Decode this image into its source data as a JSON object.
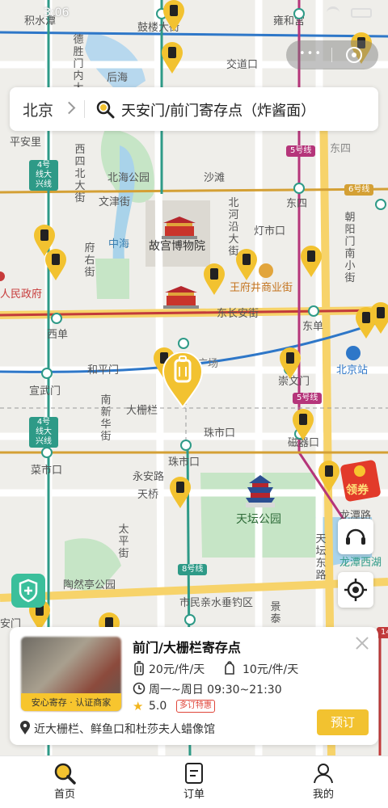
{
  "status_bar": {
    "time": "3:06"
  },
  "capsule": {
    "more": "•••"
  },
  "search": {
    "city": "北京",
    "query": "天安门/前门寄存点（炸酱面）"
  },
  "map_labels": {
    "jishuitan": "积水潭",
    "gulou": "鼓楼大街",
    "yonghegong": "雍和宫",
    "dongzhimen": "东直门",
    "deshengmen": "德胜门内大街",
    "houhai": "后海",
    "jiaodaokou": "交道口",
    "nanluogu": "南锣鼓巷",
    "pinganli": "平安里",
    "xisi": "西四北大街",
    "dongsi": "东四",
    "beihai": "北海公园",
    "wenjin": "文津街",
    "shatan": "沙滩",
    "beiheyan": "北河沿大街",
    "chaoyangmen": "朝阳门南小街",
    "zhonghai": "中海",
    "gugong": "故宫博物院",
    "dengshikou": "灯市口",
    "fuyou": "府右街",
    "wangfujing": "王府井商业街",
    "renmin": "人民政府",
    "dongchangan": "东长安街",
    "xidan": "西单",
    "dongdan": "东单",
    "beijingzhan": "北京站",
    "hepingmen": "和平门",
    "qianmen_guang": "广场",
    "xuanwumen": "宣武门",
    "chongwenmen": "崇文门",
    "nanxinhua": "南新华街",
    "dashilan": "大栅栏",
    "zhushikou_w": "珠市口",
    "zhushikou": "珠市口",
    "ciqikou": "磁器口",
    "caishikou": "菜市口",
    "yongan": "永安路",
    "tianqiao": "天桥",
    "tiantan": "天坛公园",
    "taiping": "太平街",
    "longtanlu": "龙潭路",
    "tiantandong": "天坛东路",
    "longtanxihu": "龙潭西湖",
    "taoranting": "陶然亭公园",
    "diaoyu": "市民亲水垂钓区",
    "jingtai": "景泰",
    "anmen": "安门",
    "l2": "2号线",
    "l4": "4号线大兴线",
    "l5": "5号线",
    "l6": "6号线",
    "l8": "8号线",
    "l14": "14"
  },
  "coupon": {
    "label": "领券"
  },
  "store": {
    "name": "前门/大栅栏寄存点",
    "badge": "安心寄存 · 认证商家",
    "price_luggage": "20元/件/天",
    "price_bag": "10元/件/天",
    "hours": "周一~周日 09:30~21:30",
    "rating": "5.0",
    "deal": "多订特惠",
    "book": "预订",
    "nearby": "近大栅栏、鲜鱼口和杜莎夫人蜡像馆"
  },
  "tabs": [
    {
      "label": "首页",
      "active": true
    },
    {
      "label": "订单",
      "active": false
    },
    {
      "label": "我的",
      "active": false
    }
  ],
  "colors": {
    "accent": "#f2c230",
    "brand_yellow": "#f7c52e",
    "line2": "#2e77c8",
    "line1": "#c23b3b",
    "line5": "#b5357a",
    "line4": "#2e9a87",
    "line6": "#d4a035"
  }
}
